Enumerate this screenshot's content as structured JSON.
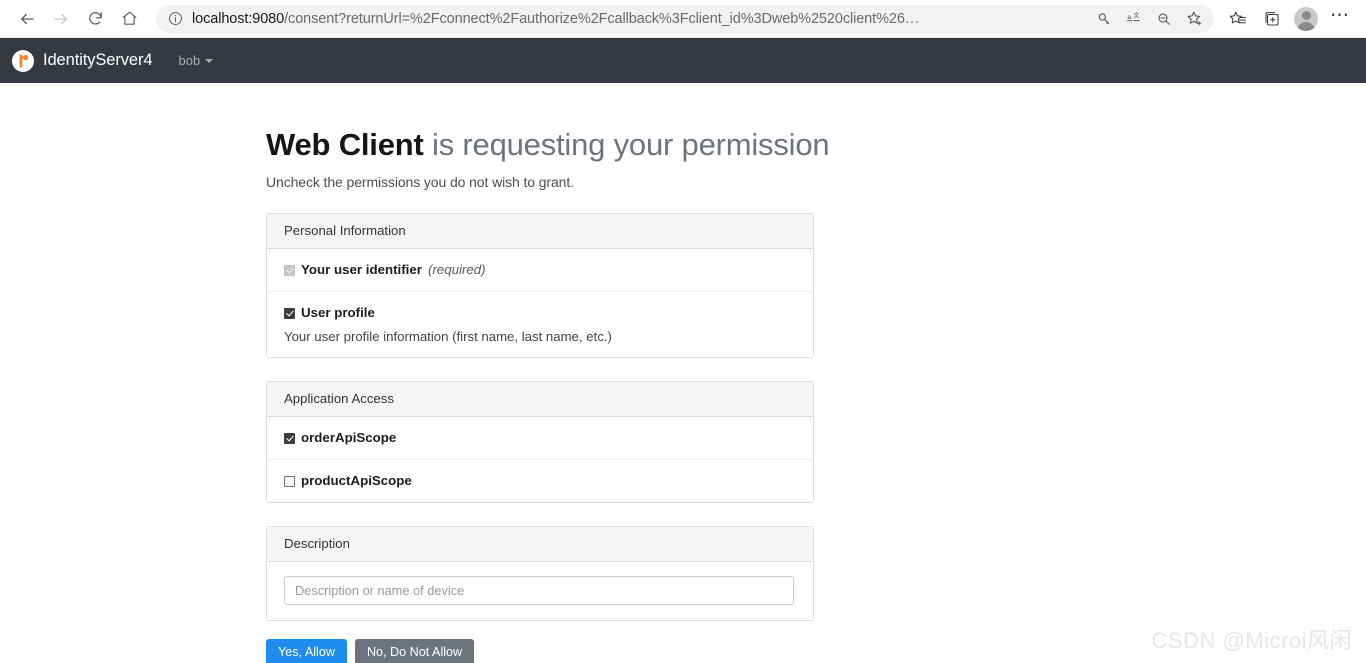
{
  "browser": {
    "nav": {
      "back_icon": "arrow-left-icon",
      "forward_icon": "arrow-right-icon",
      "refresh_icon": "refresh-icon",
      "home_icon": "home-icon"
    },
    "address_bar": {
      "info_icon": "info-circle-icon",
      "url_host": "localhost:9080",
      "url_path": "/consent?returnUrl=%2Fconnect%2Fauthorize%2Fcallback%3Fclient_id%3Dweb%2520client%26…",
      "actions": [
        "password-key-icon",
        "translate-icon",
        "zoom-out-icon",
        "favorite-star-icon"
      ]
    },
    "toolbar": {
      "favorites_icon": "favorites-list-icon",
      "collections_icon": "collections-icon",
      "profile_icon": "profile-avatar-icon",
      "settings_icon": "ellipsis-menu-icon"
    }
  },
  "navbar": {
    "logo_icon": "identityserver-logo-icon",
    "brand": "IdentityServer4",
    "username": "bob",
    "caret_icon": "caret-down-icon"
  },
  "content": {
    "heading_client": "Web Client",
    "heading_rest": "is requesting your permission",
    "subtitle": "Uncheck the permissions you do not wish to grant.",
    "panels": [
      {
        "title": "Personal Information",
        "items": [
          {
            "label": "Your user identifier",
            "note": "(required)",
            "checked": true,
            "disabled": true,
            "description": ""
          },
          {
            "label": "User profile",
            "note": "",
            "checked": true,
            "disabled": false,
            "description": "Your user profile information (first name, last name, etc.)"
          }
        ]
      },
      {
        "title": "Application Access",
        "items": [
          {
            "label": "orderApiScope",
            "note": "",
            "checked": true,
            "disabled": false,
            "description": ""
          },
          {
            "label": "productApiScope",
            "note": "",
            "checked": false,
            "disabled": false,
            "description": ""
          }
        ]
      }
    ],
    "description_panel": {
      "title": "Description",
      "input_value": "",
      "input_placeholder": "Description or name of device"
    },
    "buttons": {
      "allow": "Yes, Allow",
      "deny": "No, Do Not Allow"
    }
  },
  "watermark": "CSDN @Microi风闲",
  "colors": {
    "navbar_bg": "#343a40",
    "primary_btn": "#1f8ced",
    "secondary_btn": "#6c757d",
    "logo_accent": "#f58220"
  }
}
